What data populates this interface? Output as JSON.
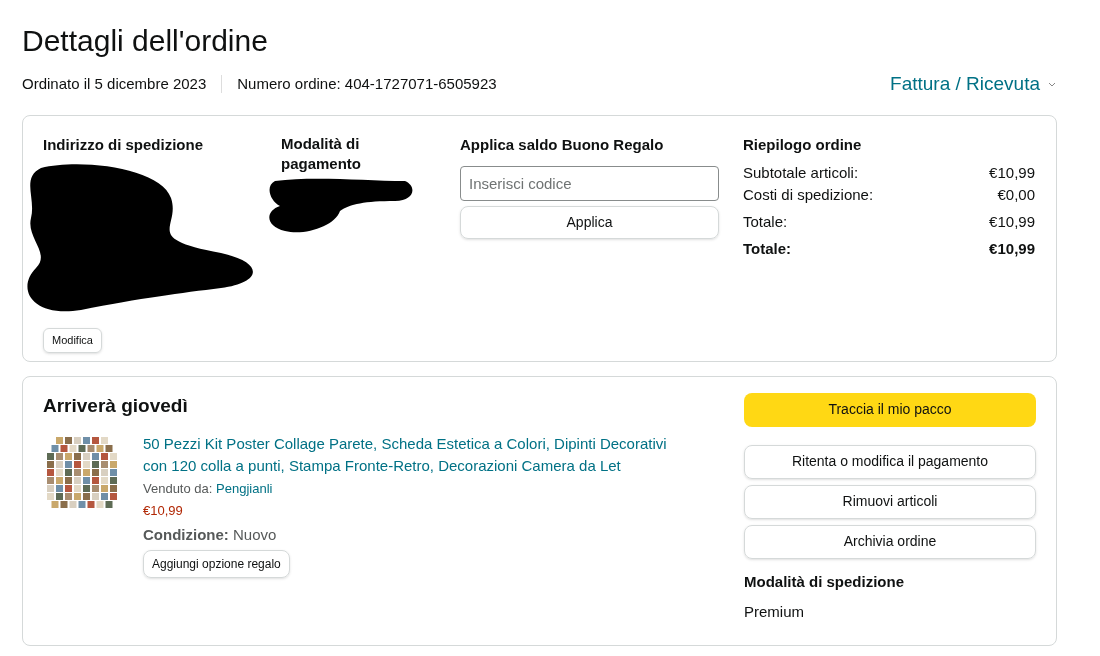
{
  "title": "Dettagli dell'ordine",
  "meta": {
    "ordered": "Ordinato il 5 dicembre 2023",
    "order_number": "Numero ordine: 404-1727071-6505923",
    "invoice_link": "Fattura / Ricevuta"
  },
  "shipping_address": {
    "heading": "Indirizzo di spedizione",
    "edit_button": "Modifica"
  },
  "payment": {
    "heading": "Modalità di pagamento"
  },
  "gift_card": {
    "heading": "Applica saldo Buono Regalo",
    "placeholder": "Inserisci codice",
    "button": "Applica"
  },
  "summary": {
    "heading": "Riepilogo ordine",
    "rows": [
      {
        "label": "Subtotale articoli:",
        "value": "€10,99",
        "kind": "line"
      },
      {
        "label": "Costi di spedizione:",
        "value": "€0,00",
        "kind": "line"
      },
      {
        "label": "Totale:",
        "value": "€10,99",
        "kind": "line"
      },
      {
        "label": "Totale:",
        "value": "€10,99",
        "kind": "total"
      }
    ]
  },
  "shipment": {
    "heading": "Arriverà giovedì",
    "item": {
      "kind": "picture",
      "title": "50 Pezzi Kit Poster Collage Parete, Scheda Estetica a Colori, Dipinti Decorativi con 120 colla a punti, Stampa Fronte-Retro, Decorazioni Camera da Let",
      "sold_by_label": "Venduto da:",
      "seller": "Pengjianli",
      "price": "€10,99",
      "condition_label": "Condizione:",
      "condition": "Nuovo",
      "gift_button": "Aggiungi opzione regalo"
    },
    "actions": [
      {
        "label": "Traccia il mio pacco",
        "kind": "primary"
      },
      {
        "label": "Ritenta o modifica il pagamento",
        "kind": "secondary"
      },
      {
        "label": "Rimuovi articoli",
        "kind": "secondary"
      },
      {
        "label": "Archivia ordine",
        "kind": "secondary"
      }
    ],
    "shipping_method": {
      "heading": "Modalità di spedizione",
      "value": "Premium"
    }
  }
}
